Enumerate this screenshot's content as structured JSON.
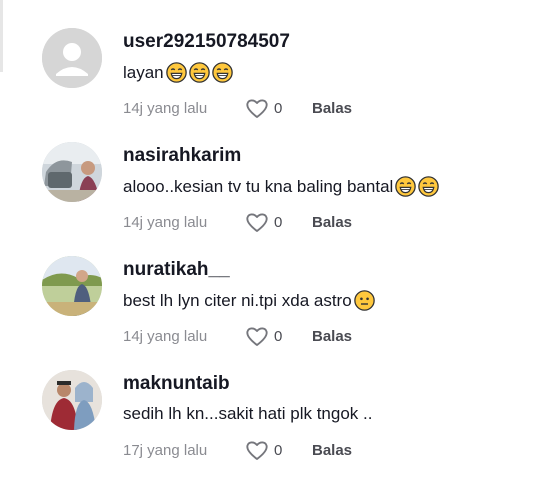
{
  "comments": [
    {
      "username": "user292150784507",
      "text": "layan",
      "emojis": [
        "grin-sweat-emoji",
        "grin-sweat-emoji",
        "grin-sweat-emoji"
      ],
      "time": "14j yang lalu",
      "likes": "0",
      "reply": "Balas",
      "avatar": "default-avatar"
    },
    {
      "username": "nasirahkarim",
      "text": "alooo..kesian tv tu kna baling bantal",
      "emojis": [
        "grin-sweat-emoji",
        "grin-sweat-emoji"
      ],
      "time": "14j yang lalu",
      "likes": "0",
      "reply": "Balas",
      "avatar": "photo-avatar"
    },
    {
      "username": "nuratikah__",
      "text": "best lh lyn citer ni.tpi xda astro",
      "emojis": [
        "neutral-face-emoji"
      ],
      "time": "14j yang lalu",
      "likes": "0",
      "reply": "Balas",
      "avatar": "photo-avatar"
    },
    {
      "username": "maknuntaib",
      "text": "sedih lh kn...sakit hati plk tngok ..",
      "emojis": [],
      "time": "17j yang lalu",
      "likes": "0",
      "reply": "Balas",
      "avatar": "photo-avatar"
    }
  ]
}
